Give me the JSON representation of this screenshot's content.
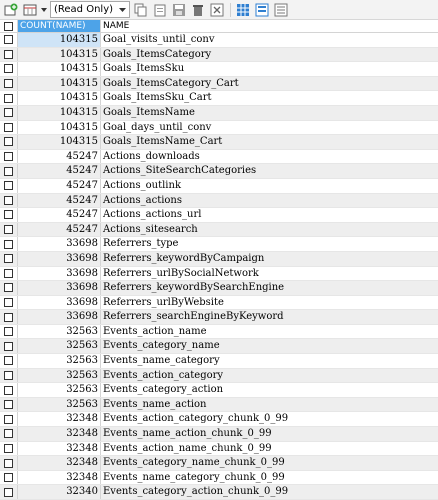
{
  "toolbar": {
    "mode_select": "(Read Only)",
    "icons": [
      "add-row-icon",
      "columns-icon",
      "copy-icon",
      "paste-icon",
      "save-icon",
      "delete-icon",
      "cancel-icon",
      "grid-view-icon",
      "form-view-icon",
      "text-view-icon"
    ]
  },
  "grid": {
    "columns": [
      "COUNT(NAME)",
      "NAME"
    ],
    "rows": [
      {
        "count": "104315",
        "name": "Goal_visits_until_conv"
      },
      {
        "count": "104315",
        "name": "Goals_ItemsCategory"
      },
      {
        "count": "104315",
        "name": "Goals_ItemsSku"
      },
      {
        "count": "104315",
        "name": "Goals_ItemsCategory_Cart"
      },
      {
        "count": "104315",
        "name": "Goals_ItemsSku_Cart"
      },
      {
        "count": "104315",
        "name": "Goals_ItemsName"
      },
      {
        "count": "104315",
        "name": "Goal_days_until_conv"
      },
      {
        "count": "104315",
        "name": "Goals_ItemsName_Cart"
      },
      {
        "count": "45247",
        "name": "Actions_downloads"
      },
      {
        "count": "45247",
        "name": "Actions_SiteSearchCategories"
      },
      {
        "count": "45247",
        "name": "Actions_outlink"
      },
      {
        "count": "45247",
        "name": "Actions_actions"
      },
      {
        "count": "45247",
        "name": "Actions_actions_url"
      },
      {
        "count": "45247",
        "name": "Actions_sitesearch"
      },
      {
        "count": "33698",
        "name": "Referrers_type"
      },
      {
        "count": "33698",
        "name": "Referrers_keywordByCampaign"
      },
      {
        "count": "33698",
        "name": "Referrers_urlBySocialNetwork"
      },
      {
        "count": "33698",
        "name": "Referrers_keywordBySearchEngine"
      },
      {
        "count": "33698",
        "name": "Referrers_urlByWebsite"
      },
      {
        "count": "33698",
        "name": "Referrers_searchEngineByKeyword"
      },
      {
        "count": "32563",
        "name": "Events_action_name"
      },
      {
        "count": "32563",
        "name": "Events_category_name"
      },
      {
        "count": "32563",
        "name": "Events_name_category"
      },
      {
        "count": "32563",
        "name": "Events_action_category"
      },
      {
        "count": "32563",
        "name": "Events_category_action"
      },
      {
        "count": "32563",
        "name": "Events_name_action"
      },
      {
        "count": "32348",
        "name": "Events_action_category_chunk_0_99"
      },
      {
        "count": "32348",
        "name": "Events_name_action_chunk_0_99"
      },
      {
        "count": "32348",
        "name": "Events_action_name_chunk_0_99"
      },
      {
        "count": "32348",
        "name": "Events_category_name_chunk_0_99"
      },
      {
        "count": "32348",
        "name": "Events_name_category_chunk_0_99"
      },
      {
        "count": "32340",
        "name": "Events_category_action_chunk_0_99"
      }
    ]
  }
}
